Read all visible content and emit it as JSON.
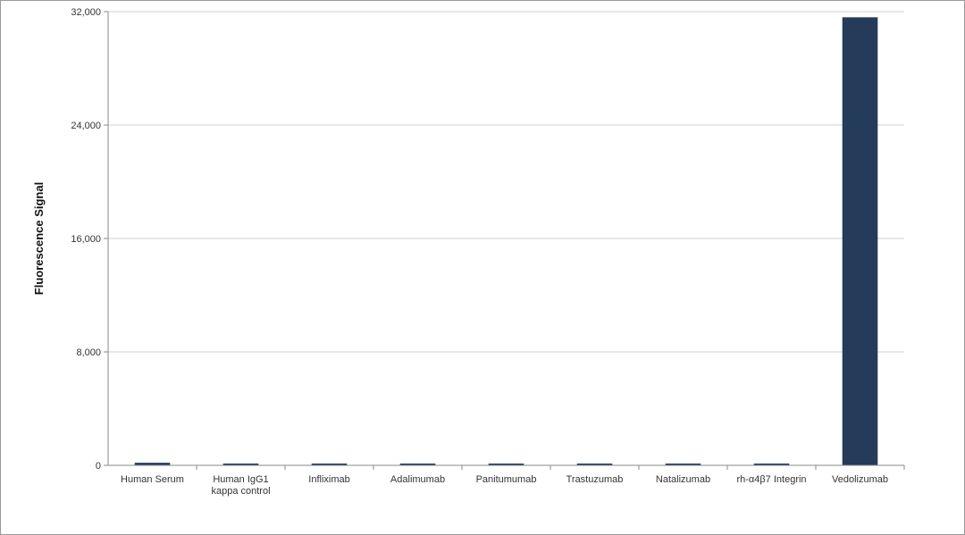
{
  "chart_data": {
    "type": "bar",
    "title": "",
    "xlabel": "",
    "ylabel": "Fluorescence Signal",
    "ylim": [
      0,
      32000
    ],
    "yticks": [
      0,
      8000,
      16000,
      24000,
      32000
    ],
    "ytick_labels": [
      "0",
      "8,000",
      "16,000",
      "24,000",
      "32,000"
    ],
    "grid": true,
    "legend": "none",
    "bar_color": "#243b5a",
    "categories": [
      "Human Serum",
      "Human IgG1 kappa control",
      "Infliximab",
      "Adalimumab",
      "Panitumumab",
      "Trastuzumab",
      "Natalizumab",
      "rh-α4β7 Integrin",
      "Vedolizumab"
    ],
    "category_lines": [
      [
        "Human Serum"
      ],
      [
        "Human IgG1",
        "kappa control"
      ],
      [
        "Infliximab"
      ],
      [
        "Adalimumab"
      ],
      [
        "Panitumumab"
      ],
      [
        "Trastuzumab"
      ],
      [
        "Natalizumab"
      ],
      [
        "rh-α4β7 Integrin"
      ],
      [
        "Vedolizumab"
      ]
    ],
    "values": [
      180,
      40,
      90,
      30,
      30,
      30,
      30,
      30,
      31600
    ]
  }
}
